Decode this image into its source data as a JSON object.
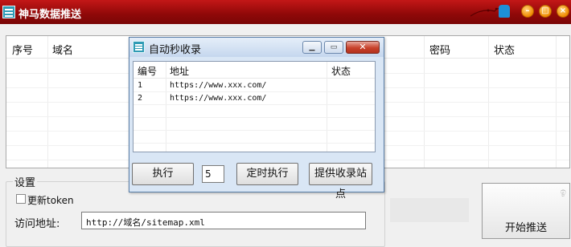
{
  "window": {
    "title": "神马数据推送",
    "controls": {
      "minimize_icon": "minimize-icon",
      "maximize_icon": "maximize-icon",
      "close_icon": "close-icon",
      "skin_icon": "tshirt-icon"
    },
    "colors": {
      "titlebar": "#a80f0f",
      "control_orange": "#f08a00"
    }
  },
  "main_list": {
    "columns": [
      "序号",
      "域名",
      "密码",
      "状态"
    ]
  },
  "settings": {
    "group_title": "设置",
    "update_token_label": "更新token",
    "update_token_checked": false,
    "url_label": "访问地址:",
    "url_value": "http://域名/sitemap.xml"
  },
  "start_button": {
    "label": "开始推送"
  },
  "dialog": {
    "title": "自动秒收录",
    "columns": [
      "编号",
      "地址",
      "状态"
    ],
    "rows": [
      {
        "id": "1",
        "url": "https://www.xxx.com/",
        "status": ""
      },
      {
        "id": "2",
        "url": "https://www.xxx.com/",
        "status": ""
      }
    ],
    "execute_label": "执行",
    "interval_value": "5",
    "timed_execute_label": "定时执行",
    "provide_site_label": "提供收录站点"
  }
}
